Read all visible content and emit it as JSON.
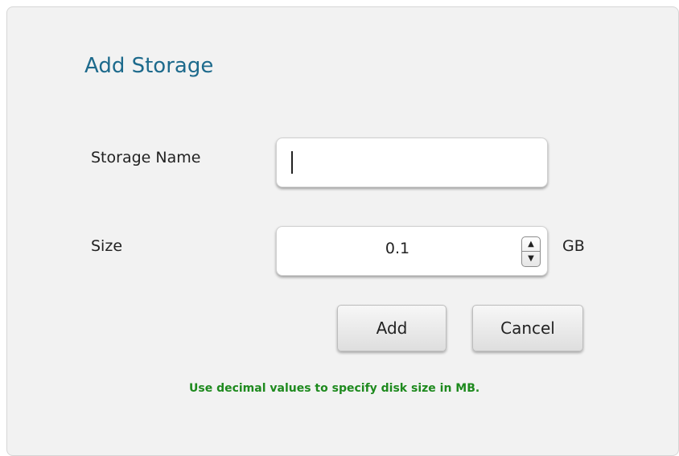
{
  "dialog": {
    "title": "Add Storage",
    "name_label": "Storage Name",
    "name_value": "",
    "size_label": "Size",
    "size_value": "0.1",
    "size_unit": "GB",
    "spinner": {
      "up_icon": "triangle-up-icon",
      "down_icon": "triangle-down-icon"
    },
    "add_button": "Add",
    "cancel_button": "Cancel",
    "hint": "Use decimal values to specify disk size in MB."
  },
  "colors": {
    "title": "#1d6a8c",
    "hint": "#1e8a1e",
    "background": "#f2f2f2"
  }
}
